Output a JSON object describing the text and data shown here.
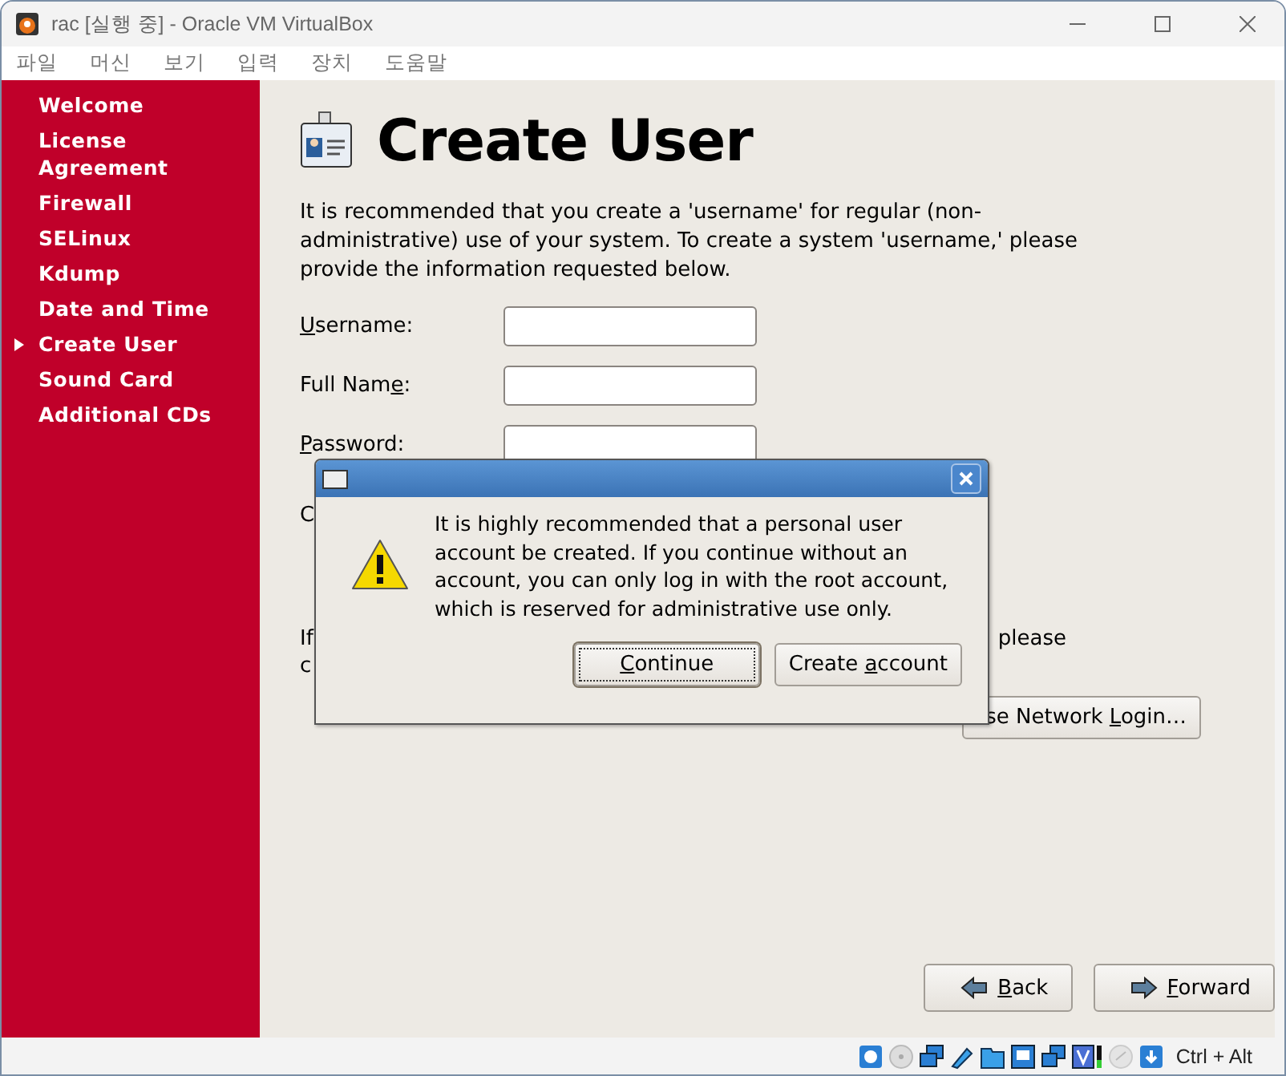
{
  "window": {
    "title": "rac [실행 중] - Oracle VM VirtualBox"
  },
  "menu": [
    "파일",
    "머신",
    "보기",
    "입력",
    "장치",
    "도움말"
  ],
  "sidebar": {
    "items": [
      {
        "label": "Welcome",
        "selected": false
      },
      {
        "label": "License Agreement",
        "selected": false
      },
      {
        "label": "Firewall",
        "selected": false
      },
      {
        "label": "SELinux",
        "selected": false
      },
      {
        "label": "Kdump",
        "selected": false
      },
      {
        "label": "Date and Time",
        "selected": false
      },
      {
        "label": "Create User",
        "selected": true
      },
      {
        "label": "Sound Card",
        "selected": false
      },
      {
        "label": "Additional CDs",
        "selected": false
      }
    ]
  },
  "page": {
    "title": "Create User",
    "intro": "It is recommended that you create a 'username' for regular (non-administrative) use of your system. To create a system 'username,' please provide the information requested below.",
    "fields": [
      {
        "label": {
          "access_key": "U",
          "after": "sername:"
        }
      },
      {
        "label": {
          "before": "Full Nam",
          "access_key": "e",
          "after": ":"
        }
      },
      {
        "label": {
          "access_key": "P",
          "after": "assword:"
        }
      }
    ],
    "confirm_fragment": "C",
    "note_fragments": {
      "line_1_start": "If",
      "line_1_end": "please",
      "line_2_start": "c"
    },
    "network_button": {
      "label": {
        "before": "se Network ",
        "access_key": "L",
        "after": "ogin…"
      }
    },
    "nav_buttons": [
      {
        "label": {
          "access_key": "B",
          "after": "ack"
        },
        "kind": "back"
      },
      {
        "label": {
          "access_key": "F",
          "after": "orward"
        },
        "kind": "forward"
      }
    ]
  },
  "dialog": {
    "message": "It is highly recommended that a personal user account be created.  If you continue without an account, you can only log in with the root account, which is reserved for administrative use only.",
    "buttons": [
      {
        "label": {
          "access_key": "C",
          "after": "ontinue"
        },
        "selected": true
      },
      {
        "label": {
          "before": "Create ",
          "access_key": "a",
          "after": "ccount"
        },
        "selected": false
      }
    ]
  },
  "status_bar": {
    "host_key": "Ctrl + Alt"
  }
}
